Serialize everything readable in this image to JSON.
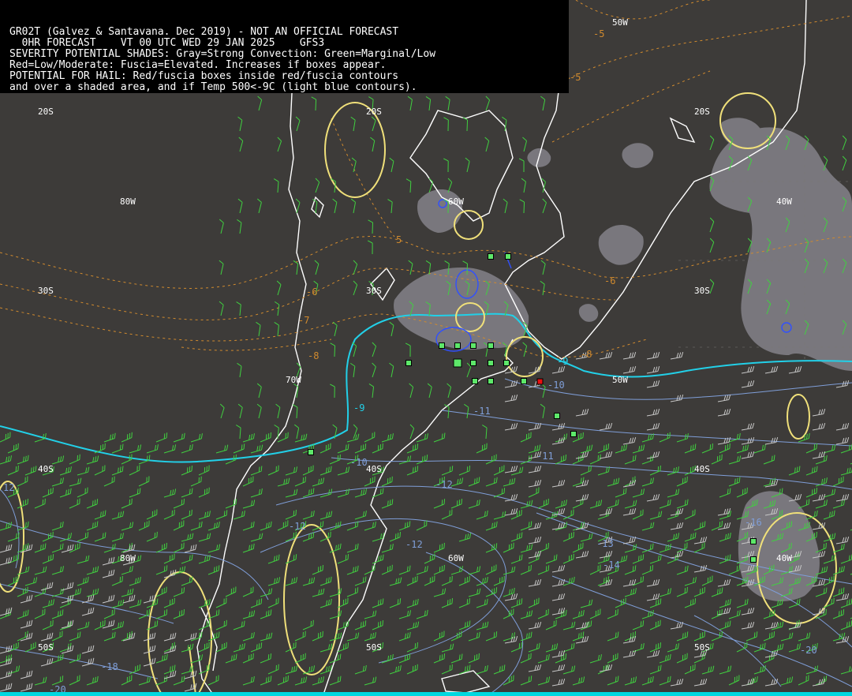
{
  "header": {
    "line1": "GR02T (Galvez & Santavana. Dec 2019) - NOT AN OFFICIAL FORECAST",
    "line2": "  0HR FORECAST    VT 00 UTC WED 29 JAN 2025    GFS3",
    "line3": "SEVERITY POTENTIAL SHADES: Gray=Strong Convection: Green=Marginal/Low",
    "line4": "Red=Low/Moderate: Fuscia=Elevated. Increases if boxes appear.",
    "line5": "POTENTIAL FOR HAIL: Red/fuscia boxes inside red/fuscia contours",
    "line6": "and over a shaded area, and if Temp 500<-9C (light blue contours)."
  },
  "grid_labels": {
    "lat_20s_a": "20S",
    "lat_20s_b": "20S",
    "lat_20s_c": "20S",
    "lat_30s_a": "30S",
    "lat_30s_b": "30S",
    "lat_30s_c": "30S",
    "lat_40s_a": "40S",
    "lat_40s_b": "40S",
    "lat_40s_c": "40S",
    "lat_50s_a": "50S",
    "lat_50s_b": "50S",
    "lat_50s_c": "50S",
    "lon_80w_a": "80W",
    "lon_80w_b": "80W",
    "lon_70w_a": "70W",
    "lon_60w_a": "60W",
    "lon_60w_b": "60W",
    "lon_50w_a": "50W",
    "lon_50w_b": "50W",
    "lon_40w_a": "40W",
    "lon_40w_b": "40W"
  },
  "contour_labels": {
    "m5a": "-5",
    "m5b": "-5",
    "m5c": "5",
    "m6a": "-6",
    "m6b": "-6",
    "m7": "-7",
    "m8a": "-8",
    "m8b": "-8",
    "m9a": "-9",
    "m9b": "-9",
    "m10a": "-10",
    "m10b": "-10",
    "m11a": "-11",
    "m11b": "-11",
    "m12a": "-12",
    "m12b": "-12",
    "m12c": "-12",
    "m13": "-13",
    "m14": "-14",
    "m16": "-16",
    "m18": "-18",
    "m20a": "-20",
    "m20b": "-20",
    "m12d": "12"
  },
  "colors": {
    "background": "#3d3b39",
    "coast": "#ffffff",
    "temp500": "#22d0e8",
    "thickness": "#d08a2e",
    "isotherm_cold": "#7f9ed8",
    "severity_yellow": "#f0e07a",
    "shade_gray": "#8e8c94",
    "box_green": "#5ee86a",
    "box_red": "#e81010",
    "wind_green": "#40d040",
    "wind_gray": "#c8c8c8",
    "blue_contour": "#3050ff"
  },
  "boxes": {
    "green_count": 22,
    "red_count": 1
  }
}
